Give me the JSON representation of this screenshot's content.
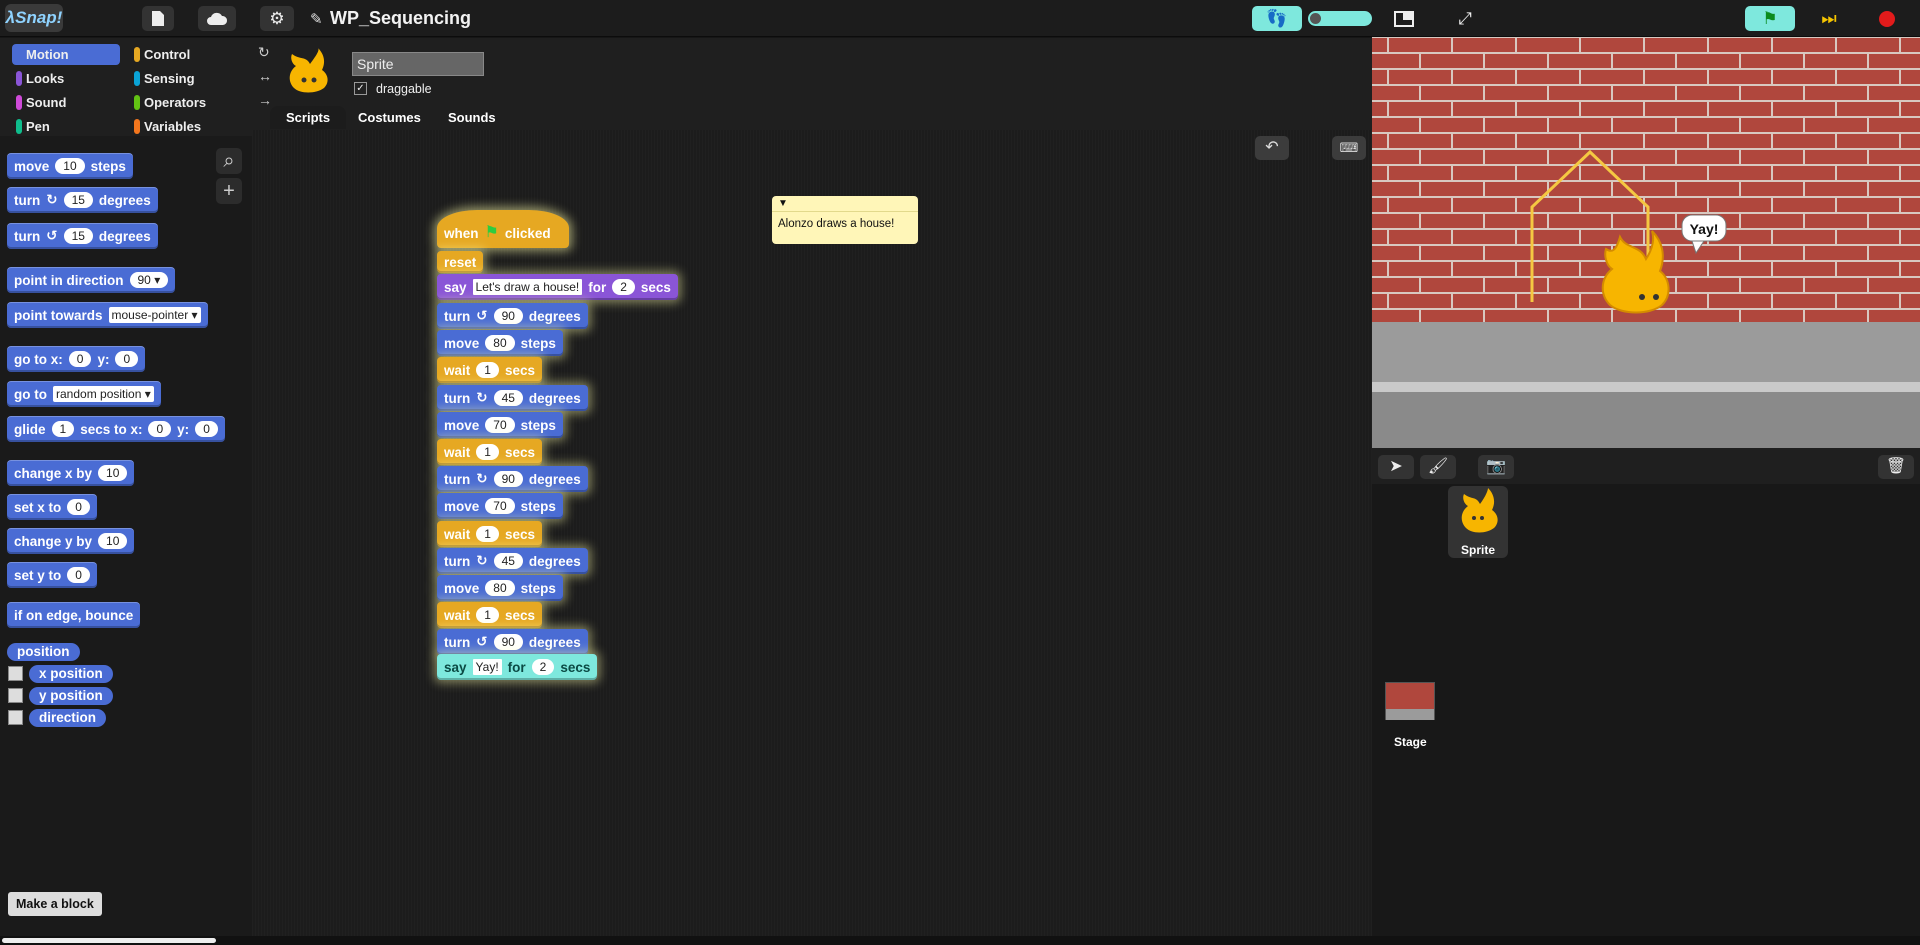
{
  "header": {
    "logo": "λSnap!",
    "project_title": "WP_Sequencing"
  },
  "categories": [
    {
      "label": "Motion",
      "color": "#4a6cd4",
      "selected": true
    },
    {
      "label": "Control",
      "color": "#e6a822",
      "selected": false
    },
    {
      "label": "Looks",
      "color": "#8a55d7",
      "selected": false
    },
    {
      "label": "Sensing",
      "color": "#0aa3d6",
      "selected": false
    },
    {
      "label": "Sound",
      "color": "#cf4ad9",
      "selected": false
    },
    {
      "label": "Operators",
      "color": "#62c213",
      "selected": false
    },
    {
      "label": "Pen",
      "color": "#0fbd8c",
      "selected": false
    },
    {
      "label": "Variables",
      "color": "#f3761d",
      "selected": false
    }
  ],
  "palette": {
    "move": {
      "a": "move",
      "v": "10",
      "b": "steps"
    },
    "turn_cw": {
      "a": "turn",
      "v": "15",
      "b": "degrees"
    },
    "turn_ccw": {
      "a": "turn",
      "v": "15",
      "b": "degrees"
    },
    "point_dir": {
      "a": "point in direction",
      "v": "90"
    },
    "point_towards": {
      "a": "point towards",
      "v": "mouse-pointer"
    },
    "goto_xy": {
      "a": "go to x:",
      "x": "0",
      "b": "y:",
      "y": "0"
    },
    "goto": {
      "a": "go to",
      "v": "random position"
    },
    "glide": {
      "a": "glide",
      "s": "1",
      "b": "secs to x:",
      "x": "0",
      "c": "y:",
      "y": "0"
    },
    "change_x": {
      "a": "change x by",
      "v": "10"
    },
    "set_x": {
      "a": "set x to",
      "v": "0"
    },
    "change_y": {
      "a": "change y by",
      "v": "10"
    },
    "set_y": {
      "a": "set y to",
      "v": "0"
    },
    "bounce": "if on edge, bounce",
    "position": "position",
    "x_position": "x position",
    "y_position": "y position",
    "direction": "direction",
    "make_block": "Make a block"
  },
  "sprite": {
    "name": "Sprite",
    "draggable_label": "draggable",
    "draggable": true
  },
  "tabs": [
    "Scripts",
    "Costumes",
    "Sounds"
  ],
  "script": {
    "hat": {
      "when": "when",
      "clicked": "clicked"
    },
    "reset": "reset",
    "say1": {
      "a": "say",
      "text": "Let's draw a house!",
      "b": "for",
      "v": "2",
      "c": "secs"
    },
    "blocks": [
      {
        "kind": "turn",
        "dir": "ccw",
        "a": "turn",
        "v": "90",
        "b": "degrees"
      },
      {
        "kind": "move",
        "a": "move",
        "v": "80",
        "b": "steps"
      },
      {
        "kind": "wait",
        "a": "wait",
        "v": "1",
        "b": "secs"
      },
      {
        "kind": "turn",
        "dir": "cw",
        "a": "turn",
        "v": "45",
        "b": "degrees"
      },
      {
        "kind": "move",
        "a": "move",
        "v": "70",
        "b": "steps"
      },
      {
        "kind": "wait",
        "a": "wait",
        "v": "1",
        "b": "secs"
      },
      {
        "kind": "turn",
        "dir": "cw",
        "a": "turn",
        "v": "90",
        "b": "degrees"
      },
      {
        "kind": "move",
        "a": "move",
        "v": "70",
        "b": "steps"
      },
      {
        "kind": "wait",
        "a": "wait",
        "v": "1",
        "b": "secs"
      },
      {
        "kind": "turn",
        "dir": "cw",
        "a": "turn",
        "v": "45",
        "b": "degrees"
      },
      {
        "kind": "move",
        "a": "move",
        "v": "80",
        "b": "steps"
      },
      {
        "kind": "wait",
        "a": "wait",
        "v": "1",
        "b": "secs"
      },
      {
        "kind": "turn",
        "dir": "ccw",
        "a": "turn",
        "v": "90",
        "b": "degrees"
      }
    ],
    "say2": {
      "a": "say",
      "text": "Yay!",
      "b": "for",
      "v": "2",
      "c": "secs"
    },
    "comment": "Alonzo draws a house!"
  },
  "stage": {
    "speech": "Yay!"
  },
  "corral": {
    "sprite_label": "Sprite",
    "stage_label": "Stage"
  }
}
